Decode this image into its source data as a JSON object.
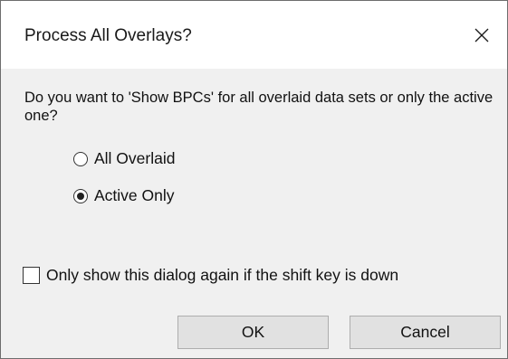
{
  "window": {
    "title": "Process All Overlays?",
    "close_icon": "close-icon"
  },
  "question": {
    "text": "Do you want to 'Show BPCs' for all overlaid data sets or only the active one?"
  },
  "options": [
    {
      "label": "All Overlaid",
      "selected": false
    },
    {
      "label": "Active Only",
      "selected": true
    }
  ],
  "checkbox": {
    "label": "Only show this dialog again if the shift key is down",
    "checked": false
  },
  "buttons": {
    "ok_label": "OK",
    "cancel_label": "Cancel"
  }
}
